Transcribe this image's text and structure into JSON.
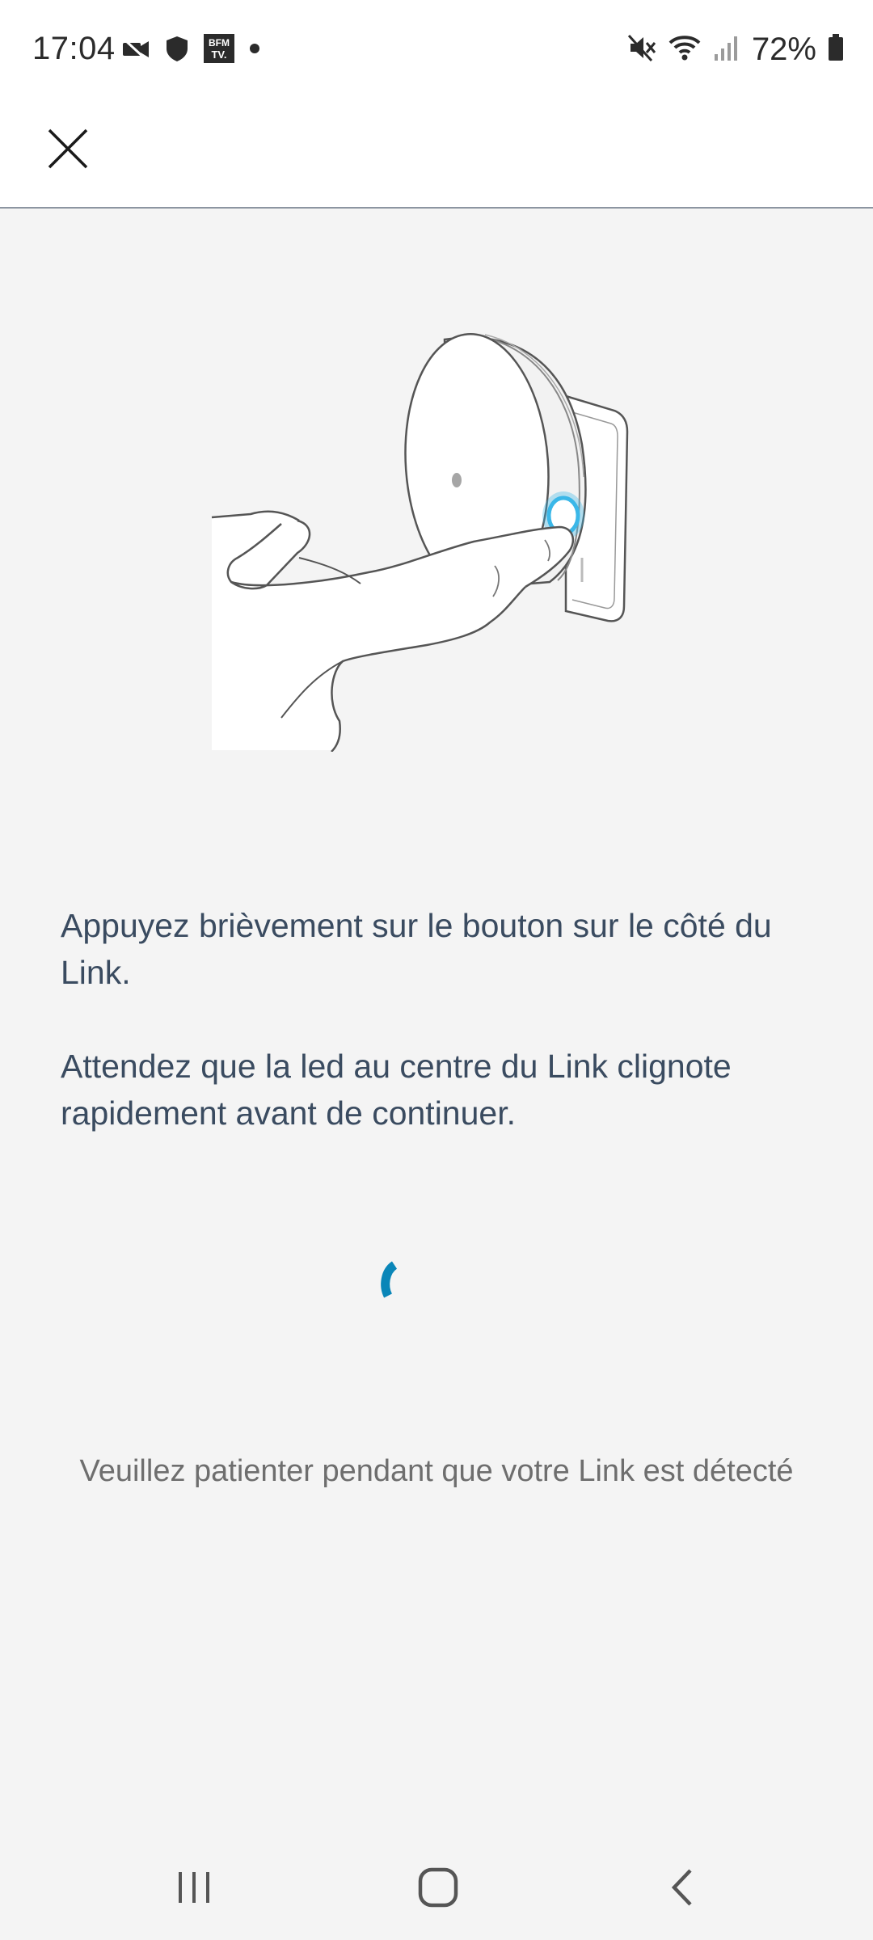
{
  "status_bar": {
    "time": "17:04",
    "battery": "72%",
    "left_icons": [
      "video-icon",
      "shield-icon",
      "bfm-tv-icon",
      "dot-icon"
    ],
    "right_icons": [
      "mute-icon",
      "wifi-icon",
      "signal-icon",
      "battery-icon"
    ],
    "bfm_tv_label_top": "BFM",
    "bfm_tv_label_bottom": "TV."
  },
  "toolbar": {
    "close_icon": "close-icon"
  },
  "instructions": {
    "paragraph_1": "Appuyez brièvement sur le bouton sur le côté du Link.",
    "paragraph_2": "Attendez que la led au centre du Link clignote rapidement avant de continuer."
  },
  "loading": {
    "spinner_color": "#0a86b8",
    "message": "Veuillez patienter pendant que votre Link est détecté"
  },
  "nav_bar": {
    "items": [
      "recent-apps-icon",
      "home-icon",
      "back-icon"
    ]
  },
  "colors": {
    "background": "#f4f4f4",
    "header": "#ffffff",
    "instruction_text": "#3a4b60",
    "secondary_text": "#6e6e6e",
    "led_glow": "#3ab7e8"
  }
}
